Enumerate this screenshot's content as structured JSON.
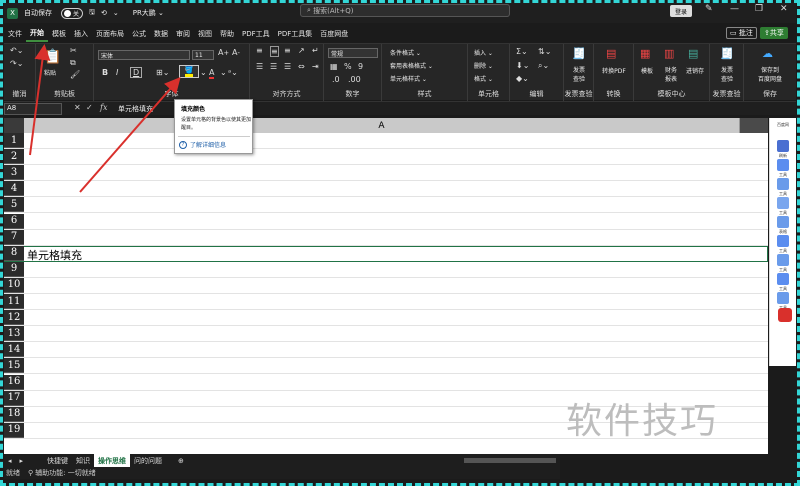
{
  "titlebar": {
    "autosave_label": "自动保存",
    "autosave_state": "关",
    "document_name": "PR大鹏",
    "search_placeholder": "搜索(Alt+Q)",
    "login_label": "登录"
  },
  "menubar": {
    "items": [
      "文件",
      "开始",
      "模板",
      "插入",
      "页面布局",
      "公式",
      "数据",
      "审阅",
      "视图",
      "帮助",
      "PDF工具",
      "PDF工具集",
      "百度网盘"
    ],
    "active": "开始",
    "comment_label": "批注",
    "share_label": "共享"
  },
  "ribbon": {
    "groups": [
      "撤消",
      "剪贴板",
      "字体",
      "对齐方式",
      "数字",
      "样式",
      "单元格",
      "编辑",
      "发票查验",
      "转换",
      "模板中心",
      "发票查验",
      "保存"
    ],
    "paste_label": "粘贴",
    "font_name": "宋体",
    "font_size": "11",
    "number_format": "常规",
    "styles": [
      "条件格式",
      "套用表格格式",
      "单元格样式"
    ],
    "cells": [
      "插入",
      "删除",
      "格式"
    ],
    "invoice_label": "发票\n查验",
    "to_pdf_label": "转换PDF",
    "template_label": "模板",
    "finance_label": "财务\n报表",
    "inout_label": "进销存",
    "invoice2_label": "发票\n查验",
    "save_baidu_label": "保存到\n百度网盘"
  },
  "tooltip": {
    "title": "填充颜色",
    "description": "设置单元格的背景色以使其更加醒目。",
    "link": "了解详细信息"
  },
  "formulabar": {
    "namebox": "A8",
    "fx": "fx",
    "content": "单元格填充"
  },
  "sheet": {
    "column": "A",
    "rows": [
      "1",
      "2",
      "3",
      "4",
      "5",
      "6",
      "7",
      "8",
      "9",
      "10",
      "11",
      "12",
      "13",
      "14",
      "15",
      "16",
      "17",
      "18",
      "19"
    ],
    "selected_row": "8",
    "cell_a8": "单元格填充"
  },
  "sidepanel": {
    "title": "百度网",
    "items": [
      "刷新",
      "工具",
      "工具",
      "工具",
      "表格",
      "工具",
      "工具",
      "工具",
      "工具"
    ]
  },
  "sheettabs": {
    "items": [
      "快捷键",
      "知识",
      "操作思维",
      "问的问题"
    ],
    "active": "操作思维"
  },
  "statusbar": {
    "ready": "就绪",
    "accessibility": "辅助功能: 一切就绪"
  },
  "watermark": "软件技巧",
  "colors": {
    "accent_green": "#217346",
    "annotation_red": "#d9302c",
    "frame_dash": "#33d6d6"
  }
}
